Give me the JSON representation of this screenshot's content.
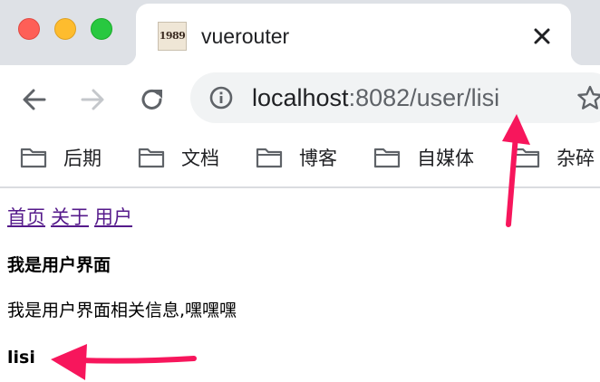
{
  "window": {
    "traffic_lights": [
      "close",
      "minimize",
      "maximize"
    ]
  },
  "tab": {
    "favicon_text": "1989",
    "title": "vuerouter",
    "close_icon": "close-icon"
  },
  "toolbar": {
    "icons": [
      "back-arrow-icon",
      "forward-arrow-icon",
      "reload-icon"
    ],
    "omnibox": {
      "host": "localhost",
      "path": ":8082/user/lisi",
      "icon": "info-icon"
    },
    "star_icon": "star-icon"
  },
  "bookmarks": {
    "items": [
      {
        "label": "后期",
        "icon": "folder-icon"
      },
      {
        "label": "文档",
        "icon": "folder-icon"
      },
      {
        "label": "博客",
        "icon": "folder-icon"
      },
      {
        "label": "自媒体",
        "icon": "folder-icon"
      },
      {
        "label": "杂碎",
        "icon": "folder-icon"
      }
    ]
  },
  "page": {
    "nav": [
      "首页",
      "关于",
      "用户"
    ],
    "heading": "我是用户界面",
    "info": "我是用户界面相关信息,嘿嘿嘿",
    "username": "lisi"
  },
  "colors": {
    "arrow": "#f7165c",
    "link_visited": "#551a8b",
    "tabstrip": "#dee1e6",
    "omnibox": "#f1f3f4"
  }
}
